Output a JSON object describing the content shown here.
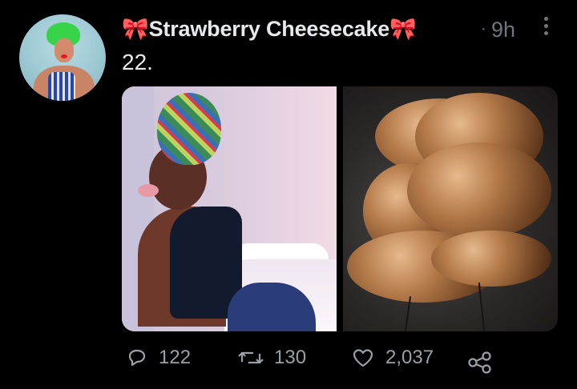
{
  "tweet": {
    "author": {
      "name": "Strawberry Cheesecake",
      "left_emoji": "🎀",
      "right_emoji": "🎀"
    },
    "time": "9h",
    "dot": "·",
    "text": "22.",
    "metrics": {
      "replies": "122",
      "retweets": "130",
      "likes": "2,037"
    }
  },
  "icons": {
    "more": "more-vertical-icon",
    "reply": "reply-icon",
    "retweet": "retweet-icon",
    "like": "heart-icon",
    "share": "share-icon"
  },
  "colors": {
    "background": "#000000",
    "text": "#e7e9ea",
    "secondary": "#71767b",
    "icons": "#9aa0a6",
    "bow": "#e8283a"
  }
}
